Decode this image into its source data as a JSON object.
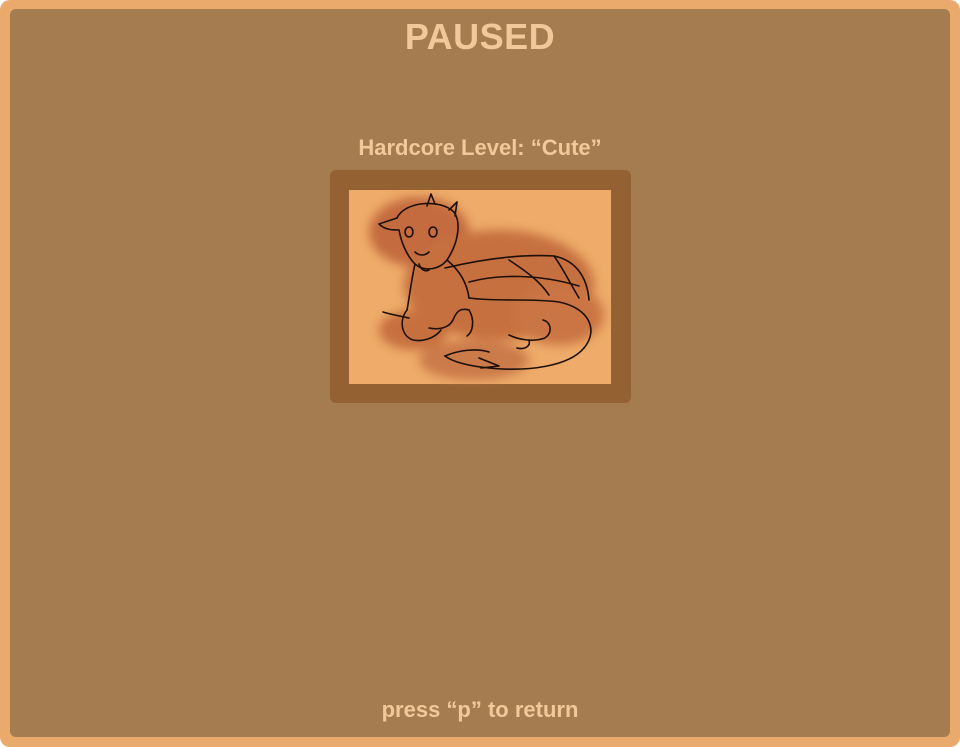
{
  "pause_screen": {
    "title": "PAUSED",
    "level_label": "Hardcore Level: “Cute”",
    "image_subject": "dragon-illustration",
    "return_hint": "press “p” to return"
  },
  "colors": {
    "outer_border": "#e9aa6c",
    "panel_background": "#a47c50",
    "text": "#f0c99b",
    "frame": "#946232",
    "picture_background": "#eeab69",
    "dragon_fill": "#c26a3b"
  }
}
